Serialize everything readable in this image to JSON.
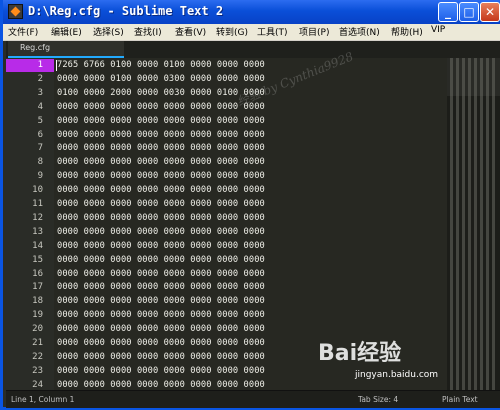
{
  "window": {
    "title": "D:\\Reg.cfg - Sublime Text 2"
  },
  "menu": [
    "文件(F)",
    "编辑(E)",
    "选择(S)",
    "查找(I)",
    "查看(V)",
    "转到(G)",
    "工具(T)",
    "项目(P)",
    "首选项(N)",
    "帮助(H)",
    "VIP"
  ],
  "tab": {
    "label": "Reg.cfg"
  },
  "lines": [
    "7265 6766 0100 0000 0100 0000 0000 0000",
    "0000 0000 0100 0000 0300 0000 0000 0000",
    "0100 0000 2000 0000 0030 0000 0100 0000",
    "0000 0000 0000 0000 0000 0000 0000 0000",
    "0000 0000 0000 0000 0000 0000 0000 0000",
    "0000 0000 0000 0000 0000 0000 0000 0000",
    "0000 0000 0000 0000 0000 0000 0000 0000",
    "0000 0000 0000 0000 0000 0000 0000 0000",
    "0000 0000 0000 0000 0000 0000 0000 0000",
    "0000 0000 0000 0000 0000 0000 0000 0000",
    "0000 0000 0000 0000 0000 0000 0000 0000",
    "0000 0000 0000 0000 0000 0000 0000 0000",
    "0000 0000 0000 0000 0000 0000 0000 0000",
    "0000 0000 0000 0000 0000 0000 0000 0000",
    "0000 0000 0000 0000 0000 0000 0000 0000",
    "0000 0000 0000 0000 0000 0000 0000 0000",
    "0000 0000 0000 0000 0000 0000 0000 0000",
    "0000 0000 0000 0000 0000 0000 0000 0000",
    "0000 0000 0000 0000 0000 0000 0000 0000",
    "0000 0000 0000 0000 0000 0000 0000 0000",
    "0000 0000 0000 0000 0000 0000 0000 0000",
    "0000 0000 0000 0000 0000 0000 0000 0000",
    "0000 0000 0000 0000 0000 0000 0000 0000",
    "0000 0000 0000 0000 0000 0000 0000 0000"
  ],
  "active_line": 1,
  "status": {
    "position": "Line 1, Column 1",
    "tab_size": "Tab Size: 4",
    "syntax": "Plain Text"
  },
  "watermark": {
    "author": "经验 by Cynthia9928",
    "brand": "Bai经验",
    "url": "jingyan.baidu.com"
  },
  "colors": {
    "active_line": "#b82be8",
    "tab_accent": "#22aaff",
    "title_bar": "#0a4fd8"
  }
}
